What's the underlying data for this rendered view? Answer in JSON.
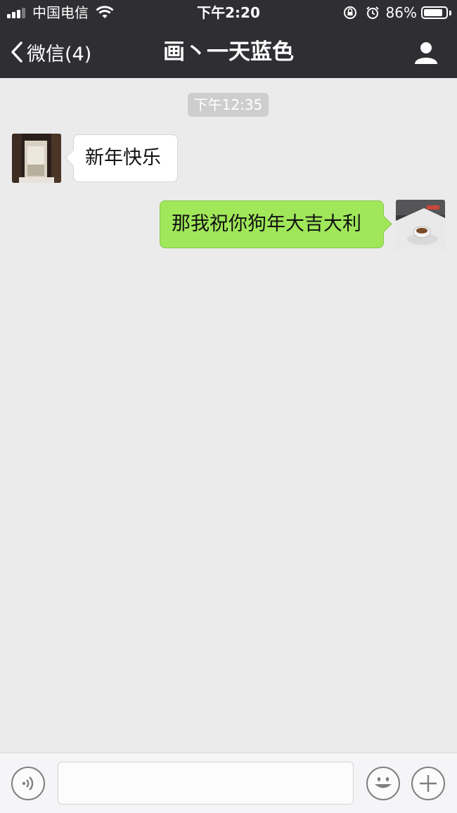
{
  "status_bar": {
    "carrier": "中国电信",
    "time": "下午2:20",
    "battery_percent_label": "86%",
    "battery_level": 0.86,
    "signal_bars_filled": 3,
    "signal_bars_total": 4
  },
  "nav": {
    "back_label": "微信(4)",
    "title": "画丶一天蓝色"
  },
  "chat": {
    "timestamp": "下午12:35",
    "messages": [
      {
        "side": "left",
        "text": "新年快乐"
      },
      {
        "side": "right",
        "text": "那我祝你狗年大吉大利"
      }
    ]
  },
  "input": {
    "placeholder": ""
  },
  "colors": {
    "header_bg": "#2f2f33",
    "chat_bg": "#ebebeb",
    "sent_bubble": "#a0e75a",
    "received_bubble": "#ffffff"
  }
}
